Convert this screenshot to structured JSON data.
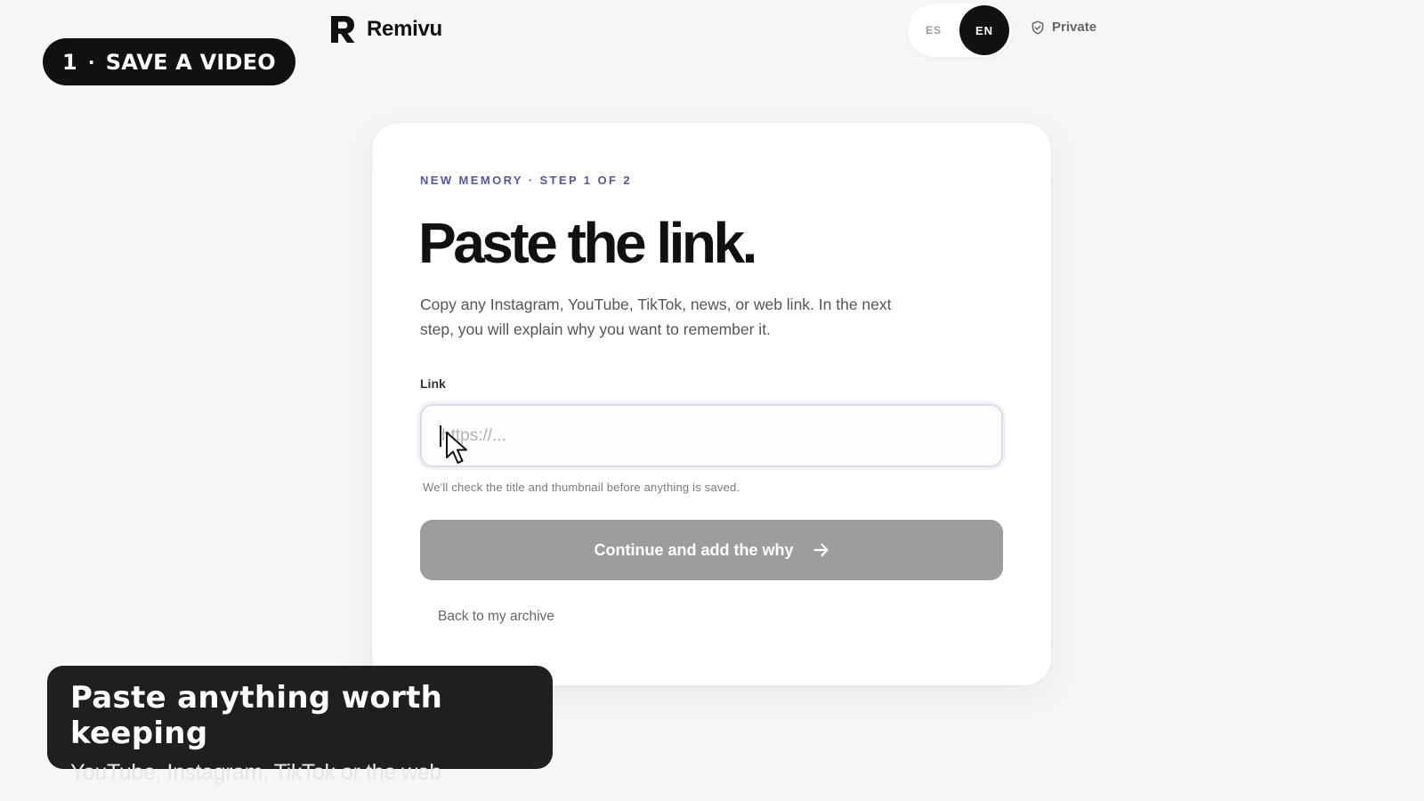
{
  "overlay": {
    "step_number": "1",
    "step_separator": "·",
    "step_label": "SAVE A VIDEO",
    "caption_title": "Paste anything worth keeping",
    "caption_subtitle": "YouTube, Instagram, TikTok or the web"
  },
  "header": {
    "brand_name": "Remivu",
    "brand_icon": "r-logo-icon",
    "languages": [
      {
        "code": "ES",
        "selected": false
      },
      {
        "code": "EN",
        "selected": true
      }
    ],
    "privacy_label": "Private",
    "privacy_icon": "shield-check-icon"
  },
  "card": {
    "eyebrow": "NEW MEMORY · STEP 1 OF 2",
    "headline": "Paste the link.",
    "description": "Copy any Instagram, YouTube, TikTok, news, or web link. In the next step, you will explain why you want to remember it.",
    "link_field": {
      "label": "Link",
      "value": "",
      "placeholder": "https://..."
    },
    "hint": "We'll check the title and thumbnail before anything is saved.",
    "continue_button": {
      "label": "Continue and add the why",
      "icon": "arrow-right-icon",
      "disabled": true
    },
    "back_link": "Back to my archive"
  },
  "colors": {
    "accent": "#55579a",
    "dark": "#111111",
    "button_disabled": "#9d9d9d",
    "background": "#f6f6f6"
  }
}
